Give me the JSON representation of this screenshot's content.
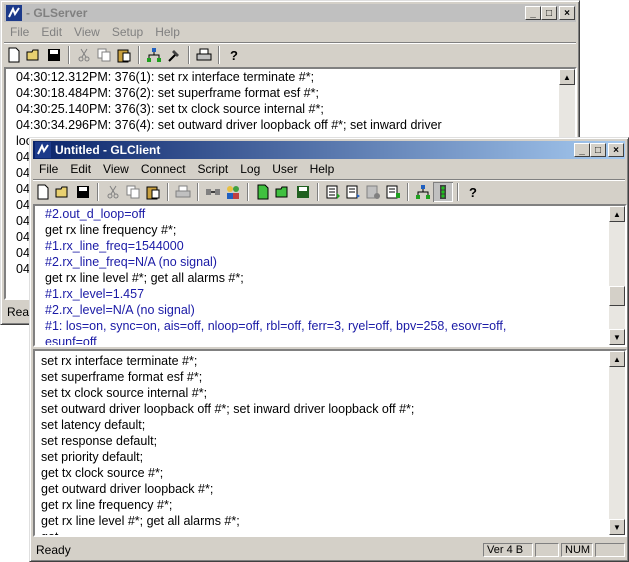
{
  "server": {
    "title": "- GLServer",
    "menu": [
      "File",
      "Edit",
      "View",
      "Setup",
      "Help"
    ],
    "log_lines": [
      "04:30:12.312PM: 376(1): set rx interface terminate #*;",
      "04:30:18.484PM: 376(2): set superframe format esf #*;",
      "04:30:25.140PM: 376(3): set tx clock source internal #*;",
      "04:30:34.296PM: 376(4): set outward driver loopback off #*; set inward driver",
      "loo",
      "04",
      "04",
      "04",
      "04",
      "04",
      "04",
      "04",
      "04"
    ],
    "status": "Read"
  },
  "client": {
    "title": "Untitled - GLClient",
    "menu": [
      "File",
      "Edit",
      "View",
      "Connect",
      "Script",
      "Log",
      "User",
      "Help"
    ],
    "output_lines": [
      {
        "text": "#2.out_d_loop=off",
        "color": "blue"
      },
      {
        "text": "get rx line frequency #*;",
        "color": "black"
      },
      {
        "text": "#1.rx_line_freq=1544000",
        "color": "blue"
      },
      {
        "text": "#2.rx_line_freq=N/A (no signal)",
        "color": "blue"
      },
      {
        "text": "get rx line level #*; get all alarms #*;",
        "color": "black"
      },
      {
        "text": "#1.rx_level=1.457",
        "color": "blue"
      },
      {
        "text": "#2.rx_level=N/A (no signal)",
        "color": "blue"
      },
      {
        "text": "#1:  los=on, sync=on, ais=off, nloop=off, rbl=off, ferr=3, ryel=off, bpv=258, esovr=off,",
        "color": "blue"
      },
      {
        "text": "esunf=off",
        "color": "blue"
      }
    ],
    "script_lines": [
      "set rx interface terminate #*;",
      "set superframe format esf #*;",
      "set tx clock source internal #*;",
      "set outward driver loopback off #*; set inward driver loopback off #*;",
      "set latency default;",
      "set response default;",
      " set priority default;",
      "get tx clock source #*;",
      "get outward driver loopback #*;",
      "get rx line frequency #*;",
      "get rx line level #*; get all alarms #*;",
      "get ..."
    ],
    "status": "Ready",
    "status_version": "Ver 4 B",
    "status_num": "NUM"
  },
  "colors": {
    "title_active": "#0a246a",
    "log_blue": "#1a1aa6",
    "window_face": "#d4d0c8"
  },
  "icons": {
    "app": "glclient-app-icon",
    "toolbar_server": [
      "new-file-icon",
      "open-folder-icon",
      "save-icon",
      "cut-icon",
      "copy-icon",
      "paste-icon",
      "network-icon",
      "hammer-icon",
      "print-icon",
      "help-icon"
    ]
  }
}
